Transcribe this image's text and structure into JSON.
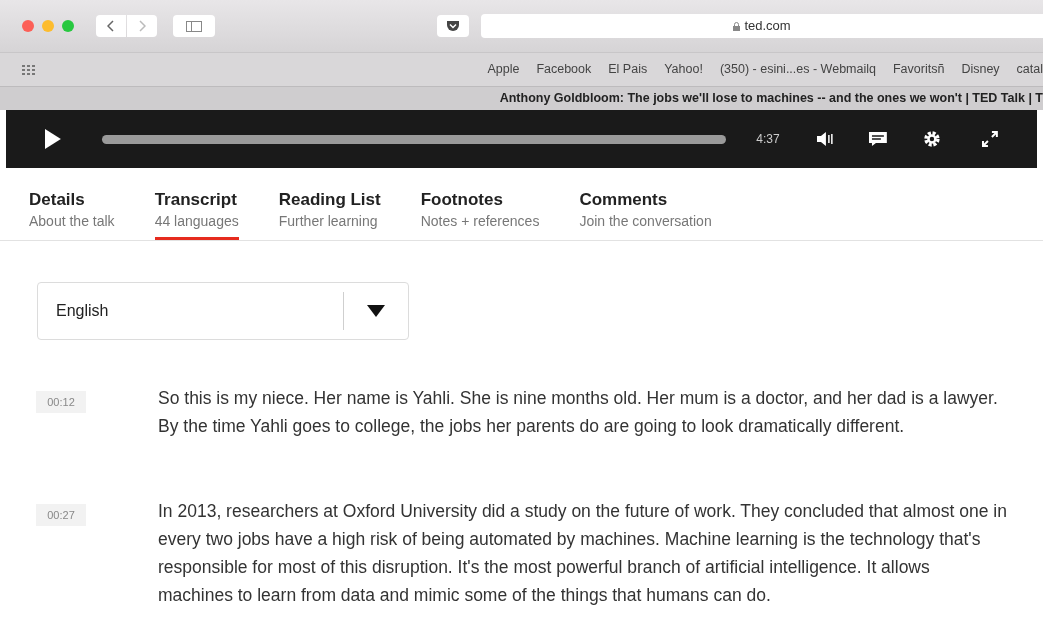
{
  "browser": {
    "address": "ted.com",
    "bookmarks": [
      "Apple",
      "Facebook",
      "El Pais",
      "Yahoo!",
      "(350) - esini...es - Webmailq",
      "Favoritsñ",
      "Disney",
      "catal"
    ],
    "tab_title": "Anthony Goldbloom: The jobs we'll lose to machines -- and the ones we won't | TED Talk | T"
  },
  "player": {
    "time": "4:37"
  },
  "tabs": [
    {
      "label": "Details",
      "sublabel": "About the talk",
      "selected": false
    },
    {
      "label": "Transcript",
      "sublabel": "44 languages",
      "selected": true
    },
    {
      "label": "Reading List",
      "sublabel": "Further learning",
      "selected": false
    },
    {
      "label": "Footnotes",
      "sublabel": "Notes + references",
      "selected": false
    },
    {
      "label": "Comments",
      "sublabel": "Join the conversation",
      "selected": false
    }
  ],
  "language_select": {
    "value": "English"
  },
  "transcript": [
    {
      "time": "00:12",
      "text": "So this is my niece. Her name is Yahli. She is nine months old. Her mum is a doctor, and her dad is a lawyer. By the time Yahli goes to college, the jobs her parents do are going to look dramatically different."
    },
    {
      "time": "00:27",
      "text": "In 2013, researchers at Oxford University did a study on the future of work. They concluded that almost one in every two jobs have a high risk of being automated by machines. Machine learning is the technology that's responsible for most of this disruption. It's the most powerful branch of artificial intelligence. It allows machines to learn from data and mimic some of the things that humans can do."
    }
  ]
}
